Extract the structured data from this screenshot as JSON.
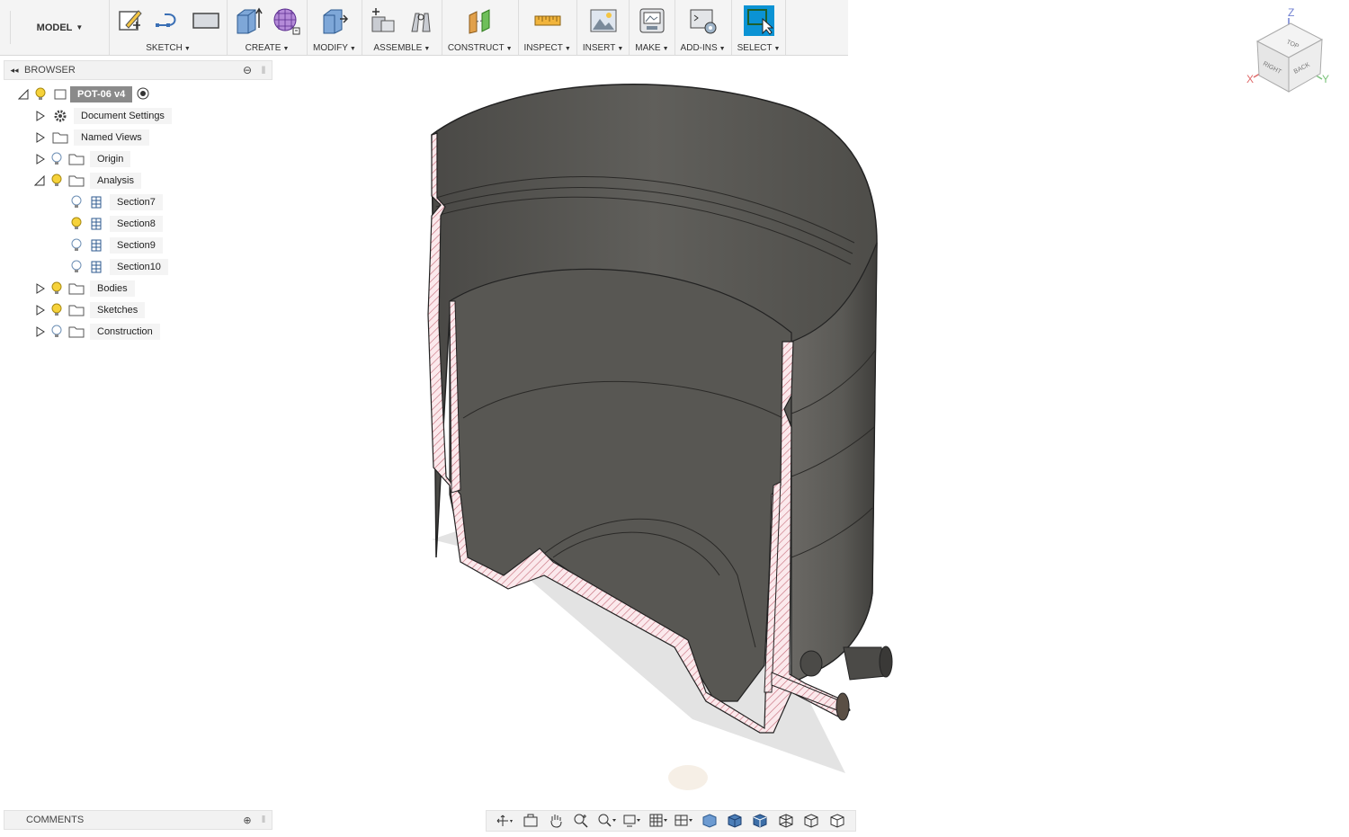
{
  "toolbar": {
    "model_label": "MODEL",
    "groups": [
      {
        "label": "SKETCH"
      },
      {
        "label": "CREATE"
      },
      {
        "label": "MODIFY"
      },
      {
        "label": "ASSEMBLE"
      },
      {
        "label": "CONSTRUCT"
      },
      {
        "label": "INSPECT"
      },
      {
        "label": "INSERT"
      },
      {
        "label": "MAKE"
      },
      {
        "label": "ADD-INS"
      },
      {
        "label": "SELECT"
      }
    ],
    "accent": "#0b93d4"
  },
  "browser": {
    "title": "BROWSER",
    "root": "POT-06 v4",
    "items": [
      {
        "label": "Document Settings",
        "icon": "gear-icon"
      },
      {
        "label": "Named Views",
        "icon": "folder-icon"
      },
      {
        "label": "Origin",
        "icon": "folder-icon"
      },
      {
        "label": "Analysis",
        "icon": "folder-icon"
      },
      {
        "label": "Section7",
        "icon": "section-analysis-icon"
      },
      {
        "label": "Section8",
        "icon": "section-analysis-icon"
      },
      {
        "label": "Section9",
        "icon": "section-analysis-icon"
      },
      {
        "label": "Section10",
        "icon": "section-analysis-icon"
      },
      {
        "label": "Bodies",
        "icon": "folder-icon"
      },
      {
        "label": "Sketches",
        "icon": "folder-icon"
      },
      {
        "label": "Construction",
        "icon": "folder-icon"
      }
    ]
  },
  "comments": {
    "title": "COMMENTS"
  },
  "viewcube": {
    "z": "Z",
    "x": "X",
    "y": "Y",
    "faces": [
      "TOP",
      "RIGHT",
      "BACK"
    ]
  }
}
